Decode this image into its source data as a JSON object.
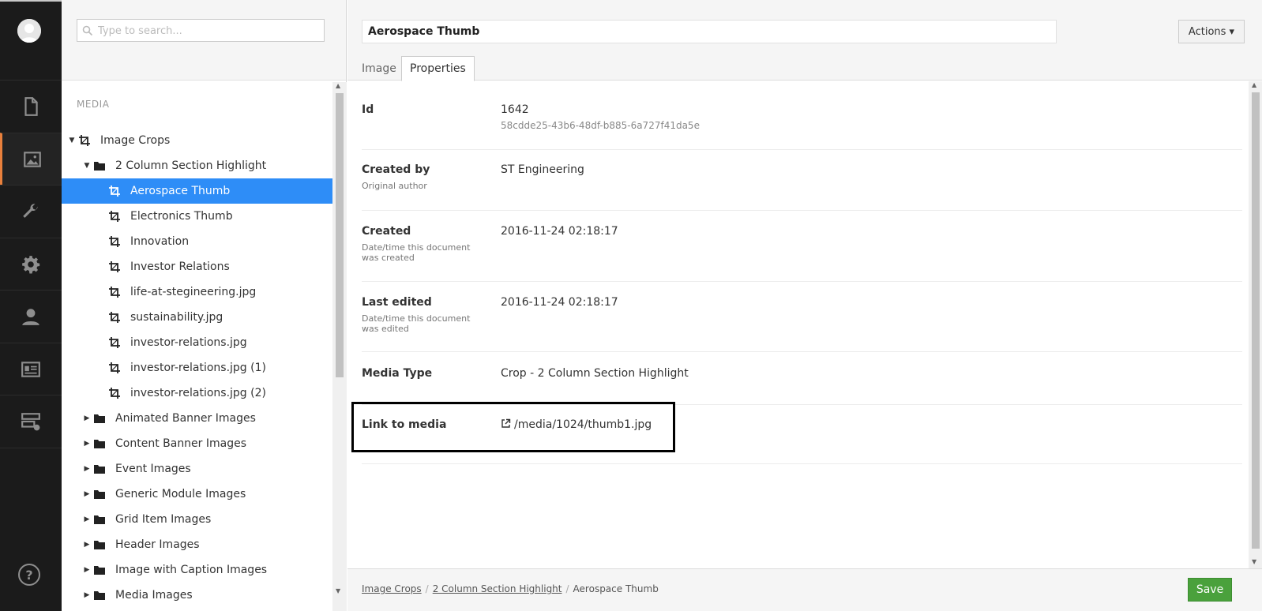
{
  "appbar": {
    "sections": [
      "content-icon",
      "media-icon",
      "developer-icon",
      "settings-icon",
      "users-icon",
      "members-icon",
      "forms-icon"
    ],
    "accent_color": "#e9803c"
  },
  "tree": {
    "search_placeholder": "Type to search...",
    "section_title": "MEDIA",
    "items": [
      {
        "label": "Image Crops",
        "level": 0,
        "icon": "crop-icon",
        "caret": "expanded"
      },
      {
        "label": "2 Column Section Highlight",
        "level": 1,
        "icon": "folder-icon",
        "caret": "expanded"
      },
      {
        "label": "Aerospace Thumb",
        "level": 2,
        "icon": "crop-icon",
        "caret": "none",
        "selected": true
      },
      {
        "label": "Electronics Thumb",
        "level": 2,
        "icon": "crop-icon",
        "caret": "none"
      },
      {
        "label": "Innovation",
        "level": 2,
        "icon": "crop-icon",
        "caret": "none"
      },
      {
        "label": "Investor Relations",
        "level": 2,
        "icon": "crop-icon",
        "caret": "none"
      },
      {
        "label": "life-at-stegineering.jpg",
        "level": 2,
        "icon": "crop-icon",
        "caret": "none"
      },
      {
        "label": "sustainability.jpg",
        "level": 2,
        "icon": "crop-icon",
        "caret": "none"
      },
      {
        "label": "investor-relations.jpg",
        "level": 2,
        "icon": "crop-icon",
        "caret": "none"
      },
      {
        "label": "investor-relations.jpg (1)",
        "level": 2,
        "icon": "crop-icon",
        "caret": "none"
      },
      {
        "label": "investor-relations.jpg (2)",
        "level": 2,
        "icon": "crop-icon",
        "caret": "none"
      },
      {
        "label": "Animated Banner Images",
        "level": 1,
        "icon": "folder-icon",
        "caret": "collapsed"
      },
      {
        "label": "Content Banner Images",
        "level": 1,
        "icon": "folder-icon",
        "caret": "collapsed"
      },
      {
        "label": "Event Images",
        "level": 1,
        "icon": "folder-icon",
        "caret": "collapsed"
      },
      {
        "label": "Generic Module Images",
        "level": 1,
        "icon": "folder-icon",
        "caret": "collapsed"
      },
      {
        "label": "Grid Item Images",
        "level": 1,
        "icon": "folder-icon",
        "caret": "collapsed"
      },
      {
        "label": "Header Images",
        "level": 1,
        "icon": "folder-icon",
        "caret": "collapsed"
      },
      {
        "label": "Image with Caption Images",
        "level": 1,
        "icon": "folder-icon",
        "caret": "collapsed"
      },
      {
        "label": "Media Images",
        "level": 1,
        "icon": "folder-icon",
        "caret": "collapsed"
      }
    ],
    "selected_color": "#2e8df7"
  },
  "editor": {
    "name_value": "Aerospace Thumb",
    "actions_label": "Actions ▾",
    "tabs": [
      {
        "label": "Image"
      },
      {
        "label": "Properties"
      }
    ],
    "properties": {
      "id": {
        "label": "Id",
        "value": "1642",
        "sub": "58cdde25-43b6-48df-b885-6a727f41da5e"
      },
      "created_by": {
        "label": "Created by",
        "desc": "Original author",
        "value": "ST Engineering"
      },
      "created": {
        "label": "Created",
        "desc": "Date/time this document was created",
        "value": "2016-11-24 02:18:17"
      },
      "last_edited": {
        "label": "Last edited",
        "desc": "Date/time this document was edited",
        "value": "2016-11-24 02:18:17"
      },
      "media_type": {
        "label": "Media Type",
        "value": "Crop - 2 Column Section Highlight"
      },
      "link": {
        "label": "Link to media",
        "value": "/media/1024/thumb1.jpg"
      }
    },
    "breadcrumb": [
      "Image Crops",
      "2 Column Section Highlight",
      "Aerospace Thumb"
    ],
    "save_label": "Save",
    "save_color": "#4aa13c"
  }
}
